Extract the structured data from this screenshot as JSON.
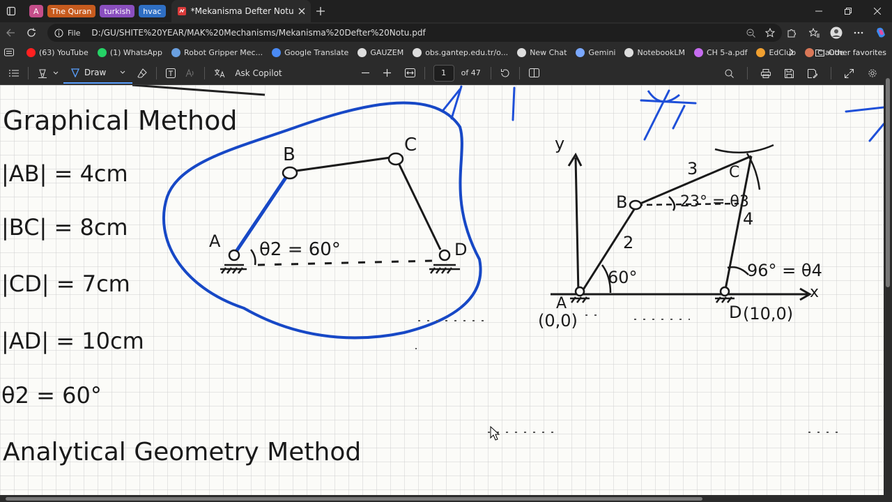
{
  "tabs": {
    "groups": [
      {
        "label": "A",
        "color": "#c44e8a"
      },
      {
        "label": "The Quran",
        "color": "#c75b1e"
      },
      {
        "label": "turkish",
        "color": "#8a4fbf"
      },
      {
        "label": "hvac",
        "color": "#2f6fc4"
      }
    ],
    "active": {
      "title": "*Mekanisma Defter Notu.pdf"
    }
  },
  "address": {
    "scheme_label": "File",
    "url": "D:/GU/SHITE%20YEAR/MAK%20Mechanisms/Mekanisma%20Defter%20Notu.pdf"
  },
  "bookmarks": [
    {
      "label": "(63) YouTube",
      "icon": "youtube-icon",
      "color": "#ff2020"
    },
    {
      "label": "(1) WhatsApp",
      "icon": "whatsapp-icon",
      "color": "#25d366"
    },
    {
      "label": "Robot Gripper Mec...",
      "icon": "robot-icon",
      "color": "#6aa0e0"
    },
    {
      "label": "Google Translate",
      "icon": "translate-icon",
      "color": "#4a8af4"
    },
    {
      "label": "GAUZEM",
      "icon": "globe-icon",
      "color": "#dddddd"
    },
    {
      "label": "obs.gantep.edu.tr/o...",
      "icon": "globe-icon",
      "color": "#dddddd"
    },
    {
      "label": "New Chat",
      "icon": "chat-icon",
      "color": "#dddddd"
    },
    {
      "label": "Gemini",
      "icon": "gemini-icon",
      "color": "#7aa8ff"
    },
    {
      "label": "NotebookLM",
      "icon": "notebook-icon",
      "color": "#dddddd"
    },
    {
      "label": "CH 5-a.pdf",
      "icon": "pdf-icon",
      "color": "#c66cf0"
    },
    {
      "label": "EdClub",
      "icon": "hand-icon",
      "color": "#f0a030"
    },
    {
      "label": "Claude",
      "icon": "claude-icon",
      "color": "#d97757"
    }
  ],
  "bookmarks_other": "Other favorites",
  "pdf_toolbar": {
    "draw_label": "Draw",
    "ask_label": "Ask Copilot",
    "page_current": "1",
    "page_total": "of 47"
  },
  "note": {
    "left_title": "Graphical Method",
    "given": [
      "|AB| = 4cm",
      "|BC| = 8cm",
      "|CD| = 7cm",
      "|AD| = 10cm",
      "θ2 = 60°"
    ],
    "left_title2": "Analytical Geometry Method",
    "sketch": {
      "A": "A",
      "B": "B",
      "C": "C",
      "D": "D",
      "theta": "θ2 = 60°"
    },
    "graph": {
      "y": "y",
      "x": "x",
      "A": "A",
      "B": "B",
      "C": "C",
      "D": "D",
      "A_coord": "(0,0)",
      "D_coord": "(10,0)",
      "link2": "2",
      "link3": "3",
      "link4": "4",
      "angle60": "60°",
      "angle23": "23° = θ3",
      "angle96": "96° = θ4"
    }
  }
}
